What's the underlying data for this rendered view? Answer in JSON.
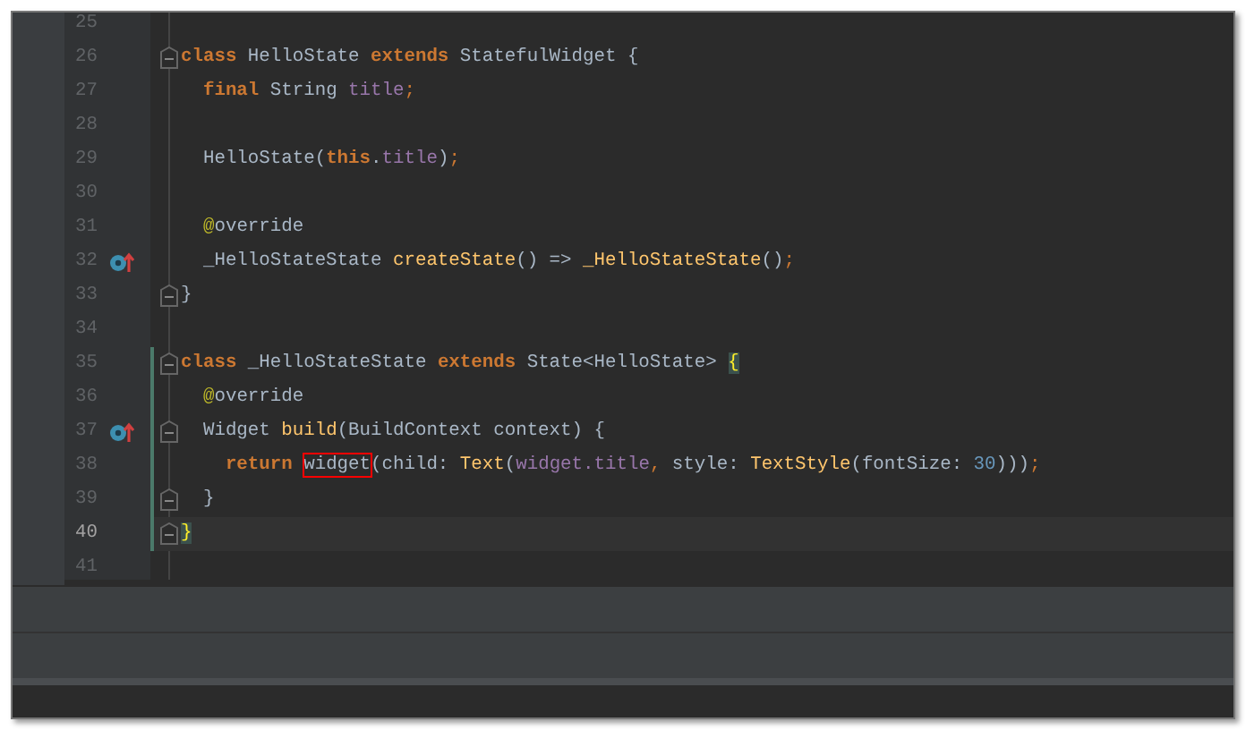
{
  "editor": {
    "lines": [
      {
        "number": "25",
        "current": false,
        "changed": false,
        "fold": false,
        "override_icon": false
      },
      {
        "number": "26",
        "current": false,
        "changed": false,
        "fold": true,
        "override_icon": false,
        "tokens": [
          {
            "text": "class",
            "kind": "keyword"
          },
          {
            "text": " HelloState ",
            "kind": "plain"
          },
          {
            "text": "extends",
            "kind": "keyword"
          },
          {
            "text": " StatefulWidget {",
            "kind": "plain"
          }
        ]
      },
      {
        "number": "27",
        "current": false,
        "changed": false,
        "fold": false,
        "override_icon": false,
        "tokens": [
          {
            "text": "  final",
            "kind": "keyword"
          },
          {
            "text": " String ",
            "kind": "plain"
          },
          {
            "text": "title",
            "kind": "field"
          },
          {
            "text": ";",
            "kind": "punct"
          }
        ]
      },
      {
        "number": "28",
        "current": false,
        "changed": false,
        "fold": false,
        "override_icon": false
      },
      {
        "number": "29",
        "current": false,
        "changed": false,
        "fold": false,
        "override_icon": false,
        "tokens": [
          {
            "text": "  HelloState(",
            "kind": "plain"
          },
          {
            "text": "this",
            "kind": "keyword"
          },
          {
            "text": ".",
            "kind": "plain"
          },
          {
            "text": "title",
            "kind": "field"
          },
          {
            "text": ")",
            "kind": "plain"
          },
          {
            "text": ";",
            "kind": "punct"
          }
        ]
      },
      {
        "number": "30",
        "current": false,
        "changed": false,
        "fold": false,
        "override_icon": false
      },
      {
        "number": "31",
        "current": false,
        "changed": false,
        "fold": false,
        "override_icon": false,
        "tokens": [
          {
            "text": "  @",
            "kind": "annotation"
          },
          {
            "text": "override",
            "kind": "plain"
          }
        ]
      },
      {
        "number": "32",
        "current": false,
        "changed": false,
        "fold": false,
        "override_icon": true,
        "tokens": [
          {
            "text": "  _HelloStateState ",
            "kind": "plain"
          },
          {
            "text": "createState",
            "kind": "method"
          },
          {
            "text": "() => ",
            "kind": "plain"
          },
          {
            "text": "_HelloStateState",
            "kind": "method"
          },
          {
            "text": "()",
            "kind": "plain"
          },
          {
            "text": ";",
            "kind": "punct"
          }
        ]
      },
      {
        "number": "33",
        "current": false,
        "changed": false,
        "fold": true,
        "override_icon": false,
        "tokens": [
          {
            "text": "}",
            "kind": "plain"
          }
        ]
      },
      {
        "number": "34",
        "current": false,
        "changed": false,
        "fold": false,
        "override_icon": false
      },
      {
        "number": "35",
        "current": false,
        "changed": true,
        "fold": true,
        "override_icon": false,
        "tokens": [
          {
            "text": "class",
            "kind": "keyword"
          },
          {
            "text": " _HelloStateState ",
            "kind": "plain"
          },
          {
            "text": "extends",
            "kind": "keyword"
          },
          {
            "text": " State<HelloState> ",
            "kind": "plain"
          },
          {
            "text": "{",
            "kind": "brace-match"
          }
        ]
      },
      {
        "number": "36",
        "current": false,
        "changed": true,
        "fold": false,
        "override_icon": false,
        "tokens": [
          {
            "text": "  @",
            "kind": "annotation"
          },
          {
            "text": "override",
            "kind": "plain"
          }
        ]
      },
      {
        "number": "37",
        "current": false,
        "changed": true,
        "fold": true,
        "override_icon": true,
        "tokens": [
          {
            "text": "  Widget ",
            "kind": "plain"
          },
          {
            "text": "build",
            "kind": "method"
          },
          {
            "text": "(BuildContext context) {",
            "kind": "plain"
          }
        ]
      },
      {
        "number": "38",
        "current": false,
        "changed": true,
        "fold": false,
        "override_icon": false,
        "tokens": [
          {
            "text": "    return ",
            "kind": "keyword"
          },
          {
            "text": "widget",
            "kind": "error"
          },
          {
            "text": "(child: ",
            "kind": "plain"
          },
          {
            "text": "Text",
            "kind": "method"
          },
          {
            "text": "(",
            "kind": "plain"
          },
          {
            "text": "widget.title",
            "kind": "field"
          },
          {
            "text": ",",
            "kind": "punct"
          },
          {
            "text": " style: ",
            "kind": "plain"
          },
          {
            "text": "TextStyle",
            "kind": "method"
          },
          {
            "text": "(fontSize: ",
            "kind": "plain"
          },
          {
            "text": "30",
            "kind": "number"
          },
          {
            "text": ")))",
            "kind": "plain"
          },
          {
            "text": ";",
            "kind": "punct"
          }
        ]
      },
      {
        "number": "39",
        "current": false,
        "changed": true,
        "fold": true,
        "override_icon": false,
        "tokens": [
          {
            "text": "  }",
            "kind": "plain"
          }
        ]
      },
      {
        "number": "40",
        "current": true,
        "changed": true,
        "fold": true,
        "override_icon": false,
        "tokens": [
          {
            "text": "}",
            "kind": "brace-match"
          }
        ]
      },
      {
        "number": "41",
        "current": false,
        "changed": false,
        "fold": false,
        "override_icon": false
      }
    ]
  }
}
